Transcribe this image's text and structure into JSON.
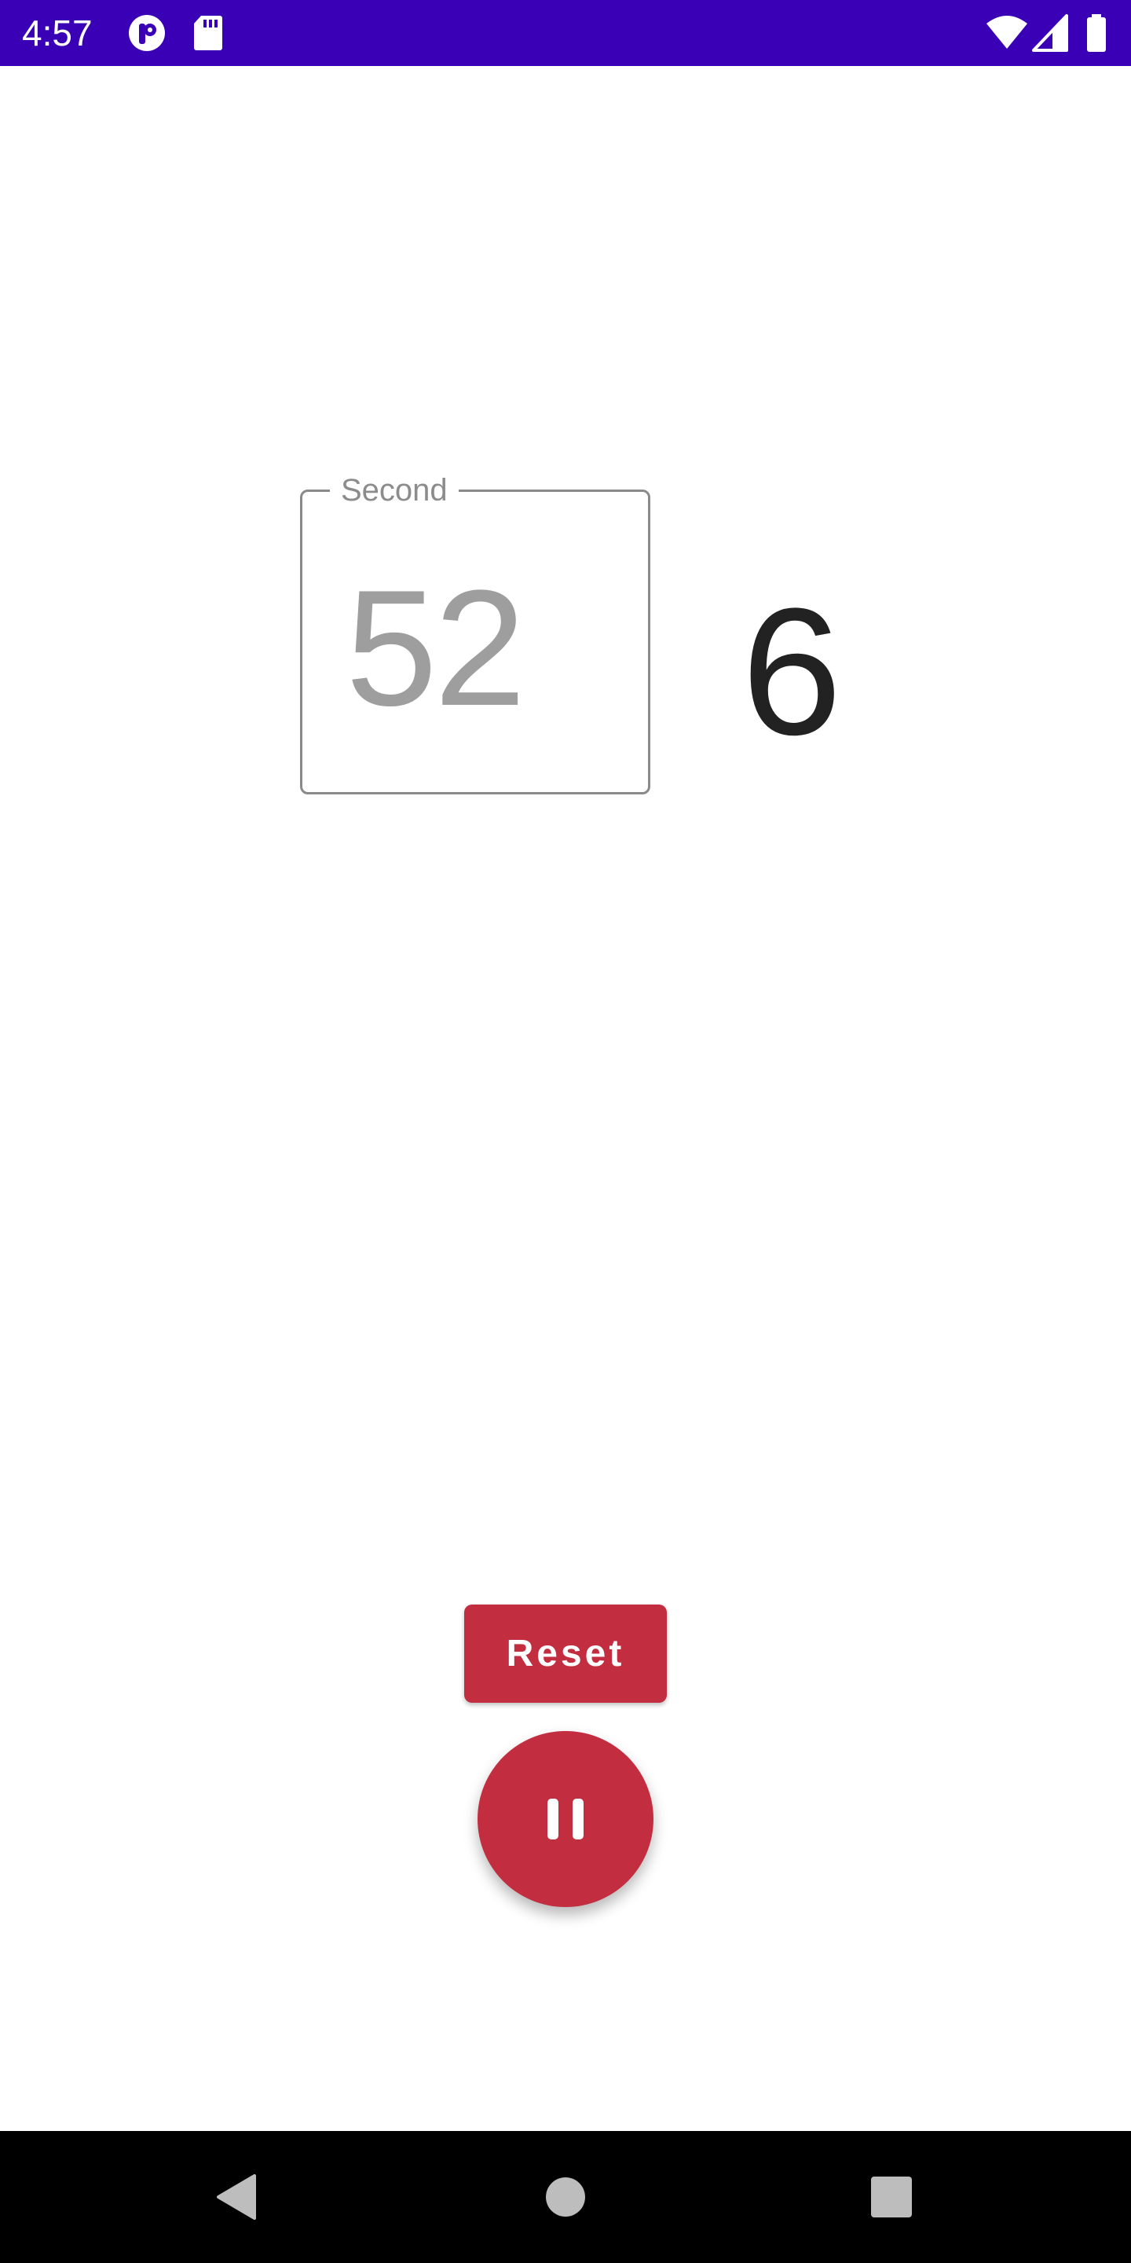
{
  "status_bar": {
    "time": "4:57",
    "background": "#3a00b6",
    "icons": [
      "app-notification-icon",
      "sd-card-icon",
      "wifi-icon",
      "cellular-signal-icon",
      "battery-icon"
    ]
  },
  "timer": {
    "field_label": "Second",
    "field_value": "52",
    "display_value": "6"
  },
  "actions": {
    "reset_label": "Reset",
    "fab_icon": "pause-icon",
    "accent": "#c22e40"
  },
  "nav_bar": {
    "icons": [
      "back-icon",
      "home-icon",
      "recents-icon"
    ]
  }
}
